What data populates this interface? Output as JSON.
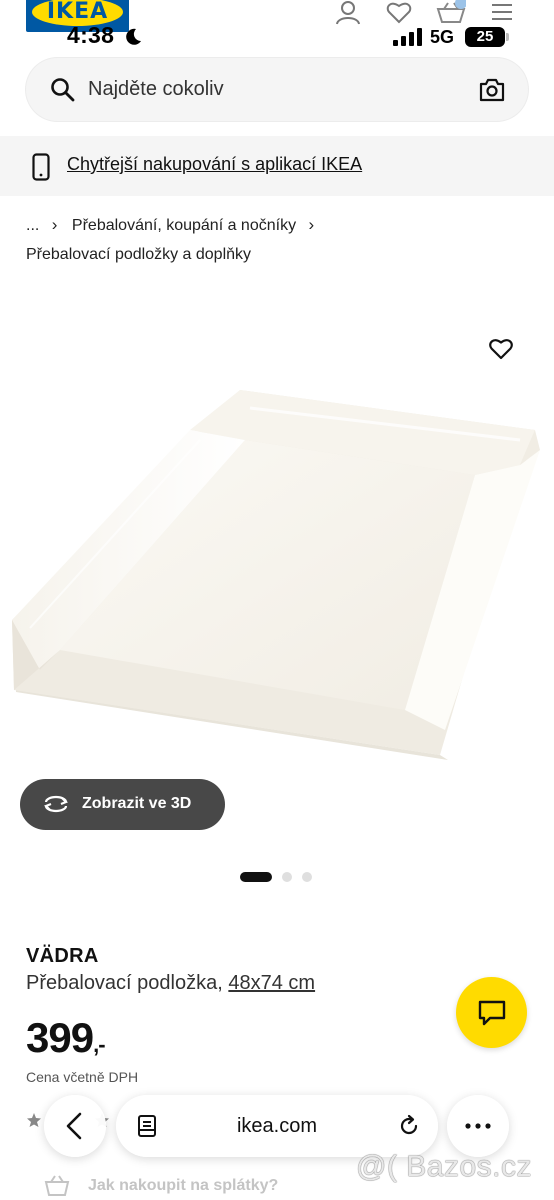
{
  "header": {
    "logo_text": "IKEA",
    "status_time": "4:38",
    "network": "5G",
    "battery": "25",
    "icons": [
      "user-icon",
      "heart-icon",
      "basket-icon",
      "menu-icon"
    ],
    "brand_blue": "#0058a3",
    "brand_yellow": "#ffdb00"
  },
  "search": {
    "placeholder": "Najděte cokoliv",
    "icons": [
      "search-icon",
      "camera-icon"
    ]
  },
  "app_banner": {
    "label": "Chytřejší nakupování s aplikací IKEA",
    "icon": "phone-icon"
  },
  "breadcrumb": {
    "ellipsis": "...",
    "parent": "Přebalování, koupání a nočníky",
    "current": "Přebalovací podložky a doplňky"
  },
  "product": {
    "name": "VÄDRA",
    "description": "Přebalovací podložka,",
    "size": "48x74 cm",
    "price": "399",
    "price_suffix": ",-",
    "vat_note": "Cena včetně DPH",
    "view_3d_label": "Zobrazit ve 3D",
    "gallery_dots": 3,
    "gallery_active": 0
  },
  "browser": {
    "domain": "ikea.com",
    "icons": [
      "back-icon",
      "reader-icon",
      "reload-icon",
      "more-icon"
    ]
  },
  "installment": {
    "label": "Jak nakoupit na splátky?"
  },
  "watermark": {
    "text": "@( Bazos.cz"
  }
}
